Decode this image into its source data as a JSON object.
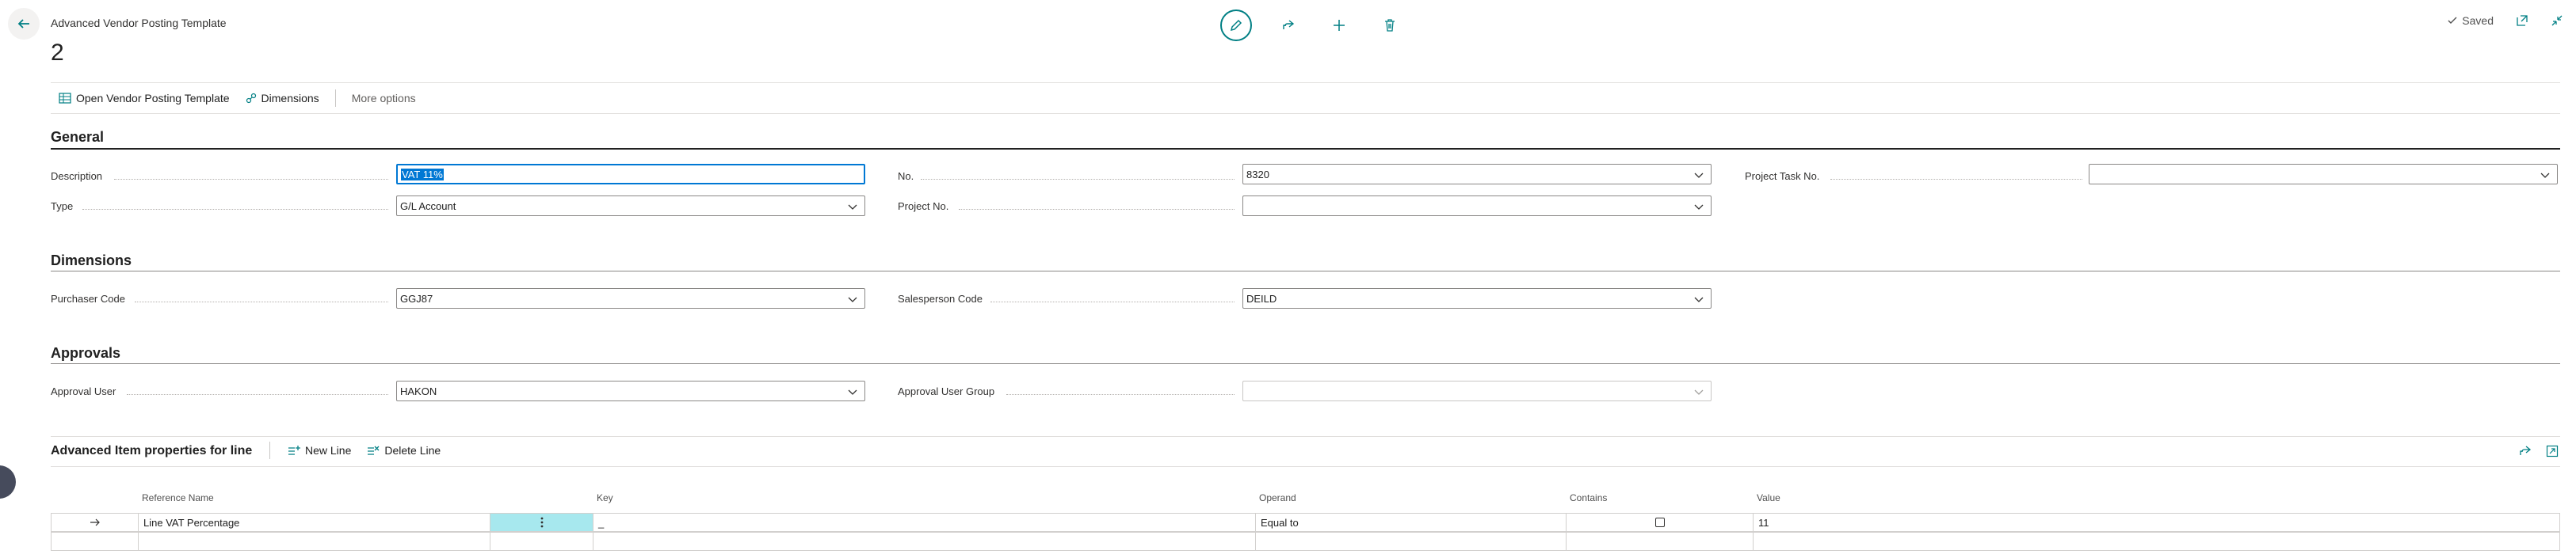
{
  "header": {
    "page_caption": "Advanced Vendor Posting Template",
    "record_title": "2",
    "saved_label": "Saved"
  },
  "actions": {
    "open_template": "Open Vendor Posting Template",
    "dimensions": "Dimensions",
    "more_options": "More options"
  },
  "general": {
    "title": "General",
    "description_label": "Description",
    "description_value": "VAT 11%",
    "type_label": "Type",
    "type_value": "G/L Account",
    "no_label": "No.",
    "no_value": "8320",
    "project_no_label": "Project No.",
    "project_no_value": "",
    "project_task_label": "Project Task No.",
    "project_task_value": ""
  },
  "dimensions": {
    "title": "Dimensions",
    "purchaser_label": "Purchaser Code",
    "purchaser_value": "GGJ87",
    "salesperson_label": "Salesperson Code",
    "salesperson_value": "DEILD"
  },
  "approvals": {
    "title": "Approvals",
    "user_label": "Approval User",
    "user_value": "HAKON",
    "group_label": "Approval User Group",
    "group_value": ""
  },
  "lines": {
    "title": "Advanced Item properties for line",
    "new_line": "New Line",
    "delete_line": "Delete Line",
    "columns": {
      "reference_name": "Reference Name",
      "key": "Key",
      "operand": "Operand",
      "contains": "Contains",
      "value": "Value"
    },
    "rows": [
      {
        "reference_name": "Line VAT Percentage",
        "key": "_",
        "operand": "Equal to",
        "contains": false,
        "value": "11"
      }
    ]
  },
  "colors": {
    "accent": "#007f84",
    "focus": "#0078d4",
    "selected_cell": "#a7e8ee"
  }
}
